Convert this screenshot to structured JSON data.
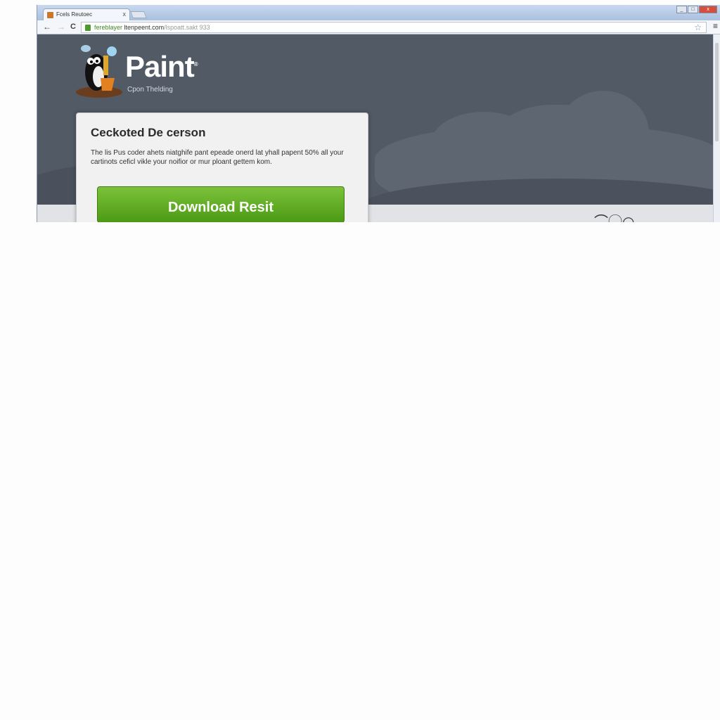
{
  "browser": {
    "tab_title": "Fcels Reutoec",
    "address_scheme": "fereblayer",
    "address_host": "ltenpeent.com",
    "address_path": "/lspoatt.sakt 933",
    "close_tab": "x"
  },
  "window_controls": {
    "minimize": "_",
    "maximize": "□",
    "close": "x"
  },
  "site": {
    "brand": "Paint",
    "brand_mark": "®",
    "tagline": "Cpon Thelding"
  },
  "card": {
    "title": "Ceckoted De cerson",
    "body": "The lis Pus coder ahets niatghife pant epeade onerd lat yhall papent 50% all your cartinots ceficl vikle your noifior or mur ploant gettem kom.",
    "button": "Download Resit"
  },
  "colors": {
    "hero": "#525a66",
    "button": "#5eab22"
  }
}
